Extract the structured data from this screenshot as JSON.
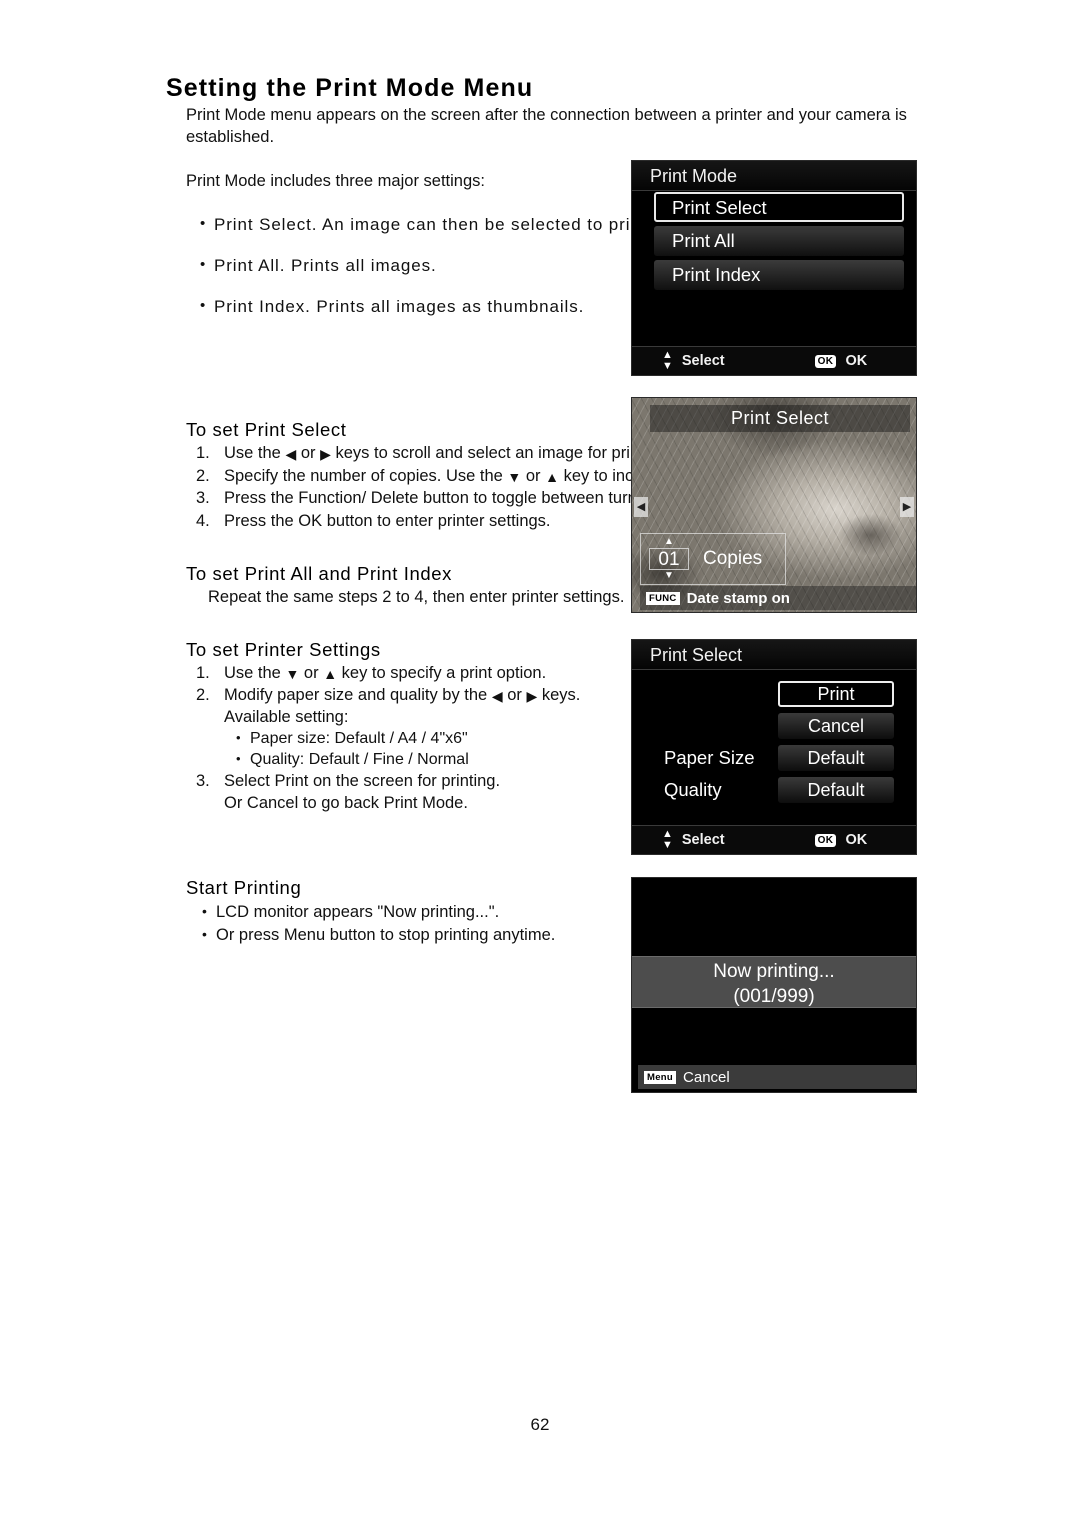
{
  "page": {
    "heading": "Setting the Print Mode Menu",
    "intro": "Print Mode menu appears on the screen after the connection between a printer and your camera is established.",
    "intro2": "Print Mode includes three major settings:",
    "page_number": "62"
  },
  "mode_bullets": [
    "Print Select. An image can then be selected to print.",
    "Print All. Prints all images.",
    "Print Index. Prints all images as thumbnails."
  ],
  "print_select_section": {
    "title": "To set Print Select",
    "steps": [
      {
        "num": "1.",
        "before": "Use the",
        "mid": "or",
        "after": "keys to scroll and select an image for printing.",
        "key1": "left",
        "key2": "right"
      },
      {
        "num": "2.",
        "before": "Specify the number of copies. Use the",
        "mid": "or",
        "after": "key to increase/decrease number.",
        "key1": "down",
        "key2": "up"
      },
      {
        "num": "3.",
        "text": "Press the Function/ Delete button to toggle between turning on/ off the date stamp."
      },
      {
        "num": "4.",
        "text": "Press the OK button to enter printer settings."
      }
    ]
  },
  "print_all_section": {
    "title": "To set Print All and Print Index",
    "body": "Repeat the same steps 2 to 4, then enter printer settings."
  },
  "printer_settings_section": {
    "title": "To set Printer Settings",
    "step1_before": "Use the",
    "step1_mid": "or",
    "step1_after": "key to specify a print option.",
    "step1_num": "1.",
    "step2_num": "2.",
    "step2_before": "Modify paper size and quality by the",
    "step2_mid": "or",
    "step2_after": "keys.",
    "step2_sub": "Available setting:",
    "options": [
      "Paper size: Default / A4 / 4\"x6\"",
      "Quality: Default / Fine / Normal"
    ],
    "step3_num": "3.",
    "step3_line1": "Select Print on the screen for printing.",
    "step3_line2": "Or Cancel to go back Print Mode."
  },
  "start_printing_section": {
    "title": "Start Printing",
    "bullets": [
      "LCD monitor appears \"Now printing...\".",
      "Or press Menu button to stop printing anytime."
    ]
  },
  "lcd_print_mode": {
    "title": "Print Mode",
    "items": [
      {
        "label": "Print Select",
        "selected": true
      },
      {
        "label": "Print All",
        "selected": false
      },
      {
        "label": "Print Index",
        "selected": false
      }
    ],
    "status_select": "Select",
    "status_ok_badge": "OK",
    "status_ok": "OK"
  },
  "lcd_print_select": {
    "title": "Print Select",
    "nav_left": "◀",
    "nav_right": "▶",
    "copies_value": "01",
    "copies_label": "Copies",
    "func_badge": "FUNC",
    "date_stamp": "Date stamp on"
  },
  "lcd_printer_settings": {
    "title": "Print Select",
    "labels": [
      "Paper Size",
      "Quality"
    ],
    "buttons": [
      {
        "label": "Print",
        "selected": true
      },
      {
        "label": "Cancel",
        "selected": false
      },
      {
        "label": "Default",
        "selected": false
      },
      {
        "label": "Default",
        "selected": false
      }
    ],
    "status_select": "Select",
    "status_ok_badge": "OK",
    "status_ok": "OK"
  },
  "lcd_now_printing": {
    "line1": "Now printing...",
    "line2": "(001/999)",
    "menu_badge": "Menu",
    "cancel_label": "Cancel"
  },
  "colors": {
    "page_bg": "#ffffff",
    "text": "#111111",
    "lcd_bg": "#000000",
    "lcd_text": "#f2f2f2",
    "band_gray": "#4d4d4d"
  }
}
